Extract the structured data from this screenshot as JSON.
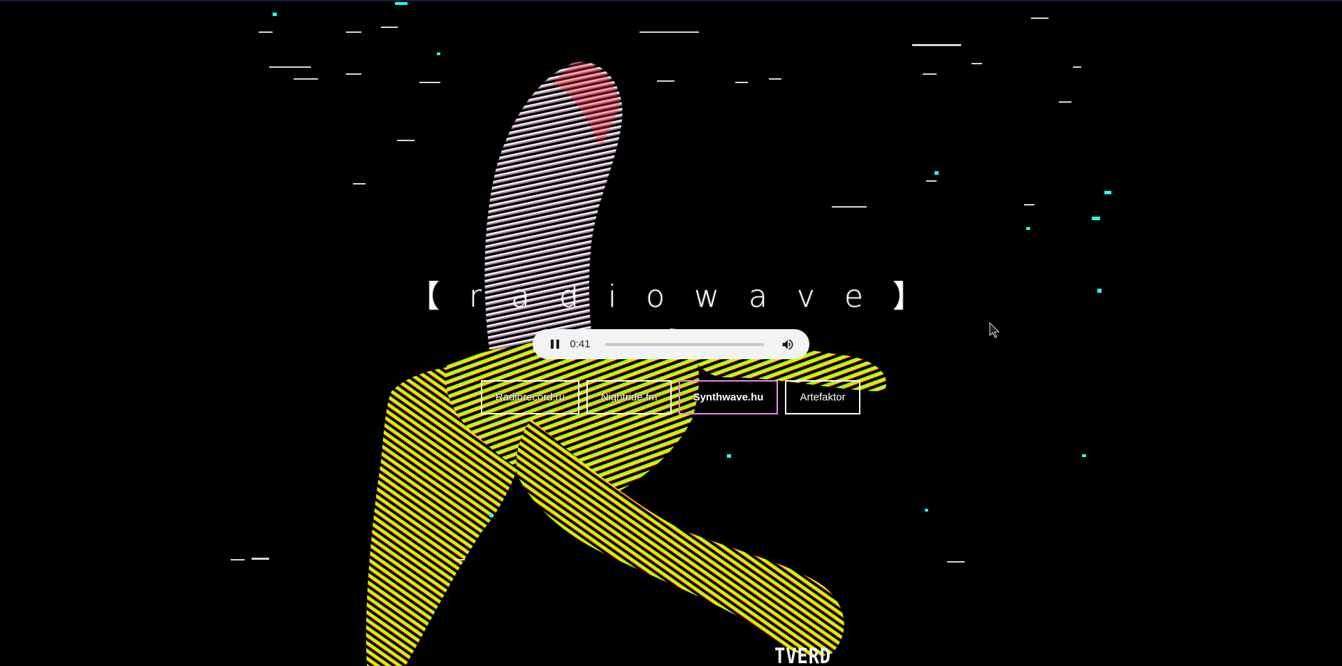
{
  "page": {
    "title": "【 r a d i o w a v e 】",
    "background_color": "#000000"
  },
  "player": {
    "state": "playing",
    "control_icon": "pause-icon",
    "time": "0:41",
    "volume_icon": "volume-icon",
    "background_color": "#f1f3f4"
  },
  "stations": [
    {
      "label": "Radiorecord.ru",
      "active": false
    },
    {
      "label": "Nightride.fm",
      "active": false
    },
    {
      "label": "Synthwave.hu",
      "active": true
    },
    {
      "label": "Artefaktor",
      "active": false
    }
  ],
  "stations_active_border_color": "#ee88ee",
  "logo": {
    "text": "TVERD"
  },
  "artwork": {
    "subject": "banana-icon",
    "colors": [
      "#b8ff00",
      "#ffea00",
      "#ff2020",
      "#ffffff",
      "#00ffe0"
    ]
  }
}
